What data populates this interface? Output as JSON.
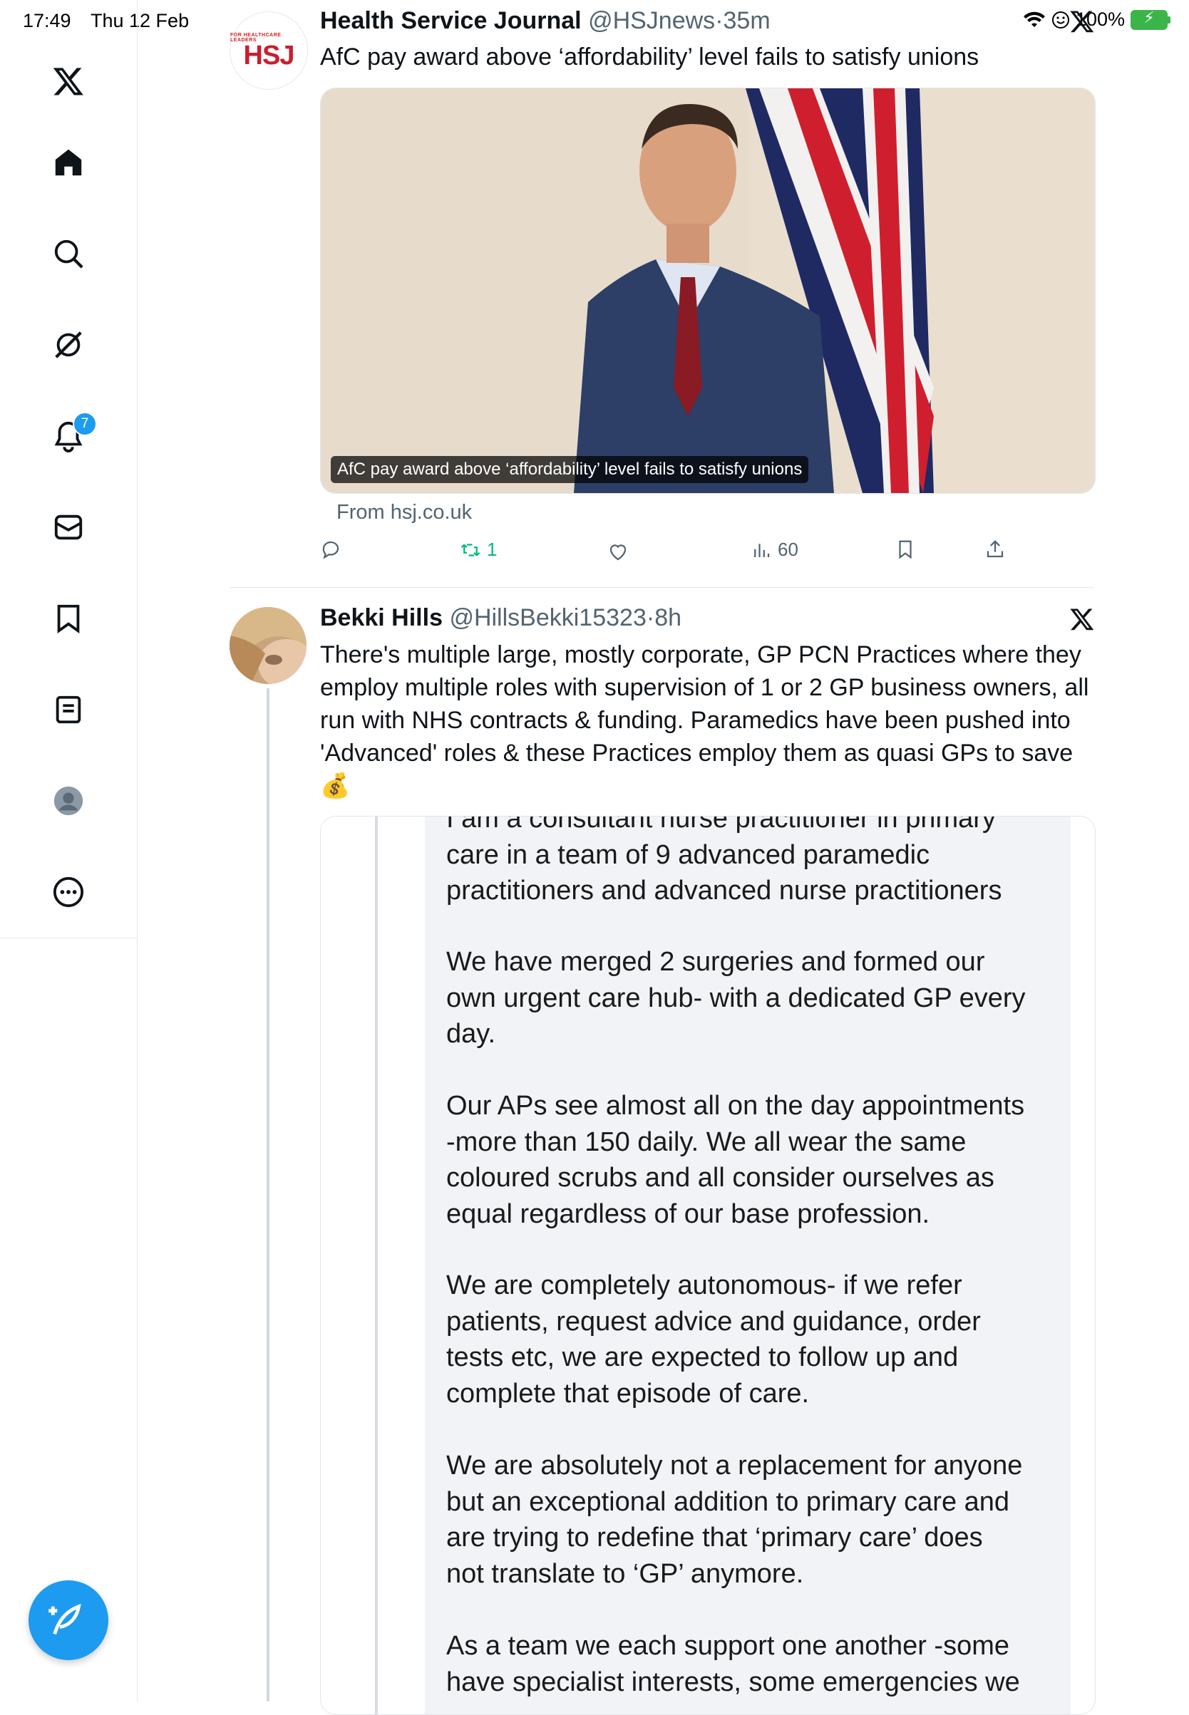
{
  "status": {
    "time": "17:49",
    "date": "Thu 12 Feb",
    "battery": "100%"
  },
  "sidebar": {
    "items": [
      {
        "name": "x-logo-icon"
      },
      {
        "name": "home-icon"
      },
      {
        "name": "search-icon"
      },
      {
        "name": "grok-icon"
      },
      {
        "name": "notifications-icon",
        "badge": "7"
      },
      {
        "name": "messages-icon"
      },
      {
        "name": "bookmarks-icon"
      },
      {
        "name": "lists-icon"
      },
      {
        "name": "profile-icon"
      },
      {
        "name": "more-icon"
      }
    ],
    "compose_icon": "compose-icon"
  },
  "tweet1": {
    "name": "Health Service Journal",
    "handle": "@HSJnews",
    "time": "35m",
    "text": "AfC pay award above ‘affordability’ level fails to satisfy unions",
    "avatar_small": "FOR HEALTHCARE LEADERS",
    "avatar_logo": "HSJ",
    "card_caption": "AfC pay award above ‘affordability’ level fails to satisfy unions",
    "card_source": "From hsj.co.uk",
    "reposts": "1",
    "views": "60"
  },
  "tweet2": {
    "name": "Bekki Hills",
    "handle": "@HillsBekki15323",
    "time": "8h",
    "text_lines": [
      "There's multiple large, mostly corporate, GP PCN Practices where they",
      "employ multiple roles with supervision of 1 or 2 GP business owners, all",
      "run with NHS contracts & funding. Paramedics have been pushed into",
      "'Advanced' roles & these Practices employ them as quasi GPs to save",
      "💰"
    ],
    "quote": {
      "p0": [
        "I am a consultant nurse practitioner in primary",
        "care in a team of 9 advanced paramedic",
        "practitioners and advanced nurse practitioners"
      ],
      "p1": [
        "We have merged 2 surgeries and formed our",
        "own urgent care hub- with a dedicated GP every",
        "day."
      ],
      "p2": [
        "Our APs see almost all on the day appointments",
        "-more than 150 daily. We all wear the same",
        "coloured scrubs and all consider ourselves as",
        "equal regardless of our base profession."
      ],
      "p3": [
        "We are completely autonomous- if we refer",
        "patients, request advice and guidance, order",
        "tests etc, we are expected to follow up and",
        "complete that episode of care."
      ],
      "p4": [
        "We are absolutely not a replacement for anyone",
        "but an exceptional addition to primary care and",
        "are trying to redefine that ‘primary care’ does",
        "not translate to ‘GP’ anymore."
      ],
      "p5": [
        "As a team we each support one another -some",
        "have specialist interests, some emergencies we"
      ]
    }
  },
  "colors": {
    "accent": "#1d9bf0",
    "repost_green": "#00ba7c",
    "hsj_red": "#c8202e"
  }
}
